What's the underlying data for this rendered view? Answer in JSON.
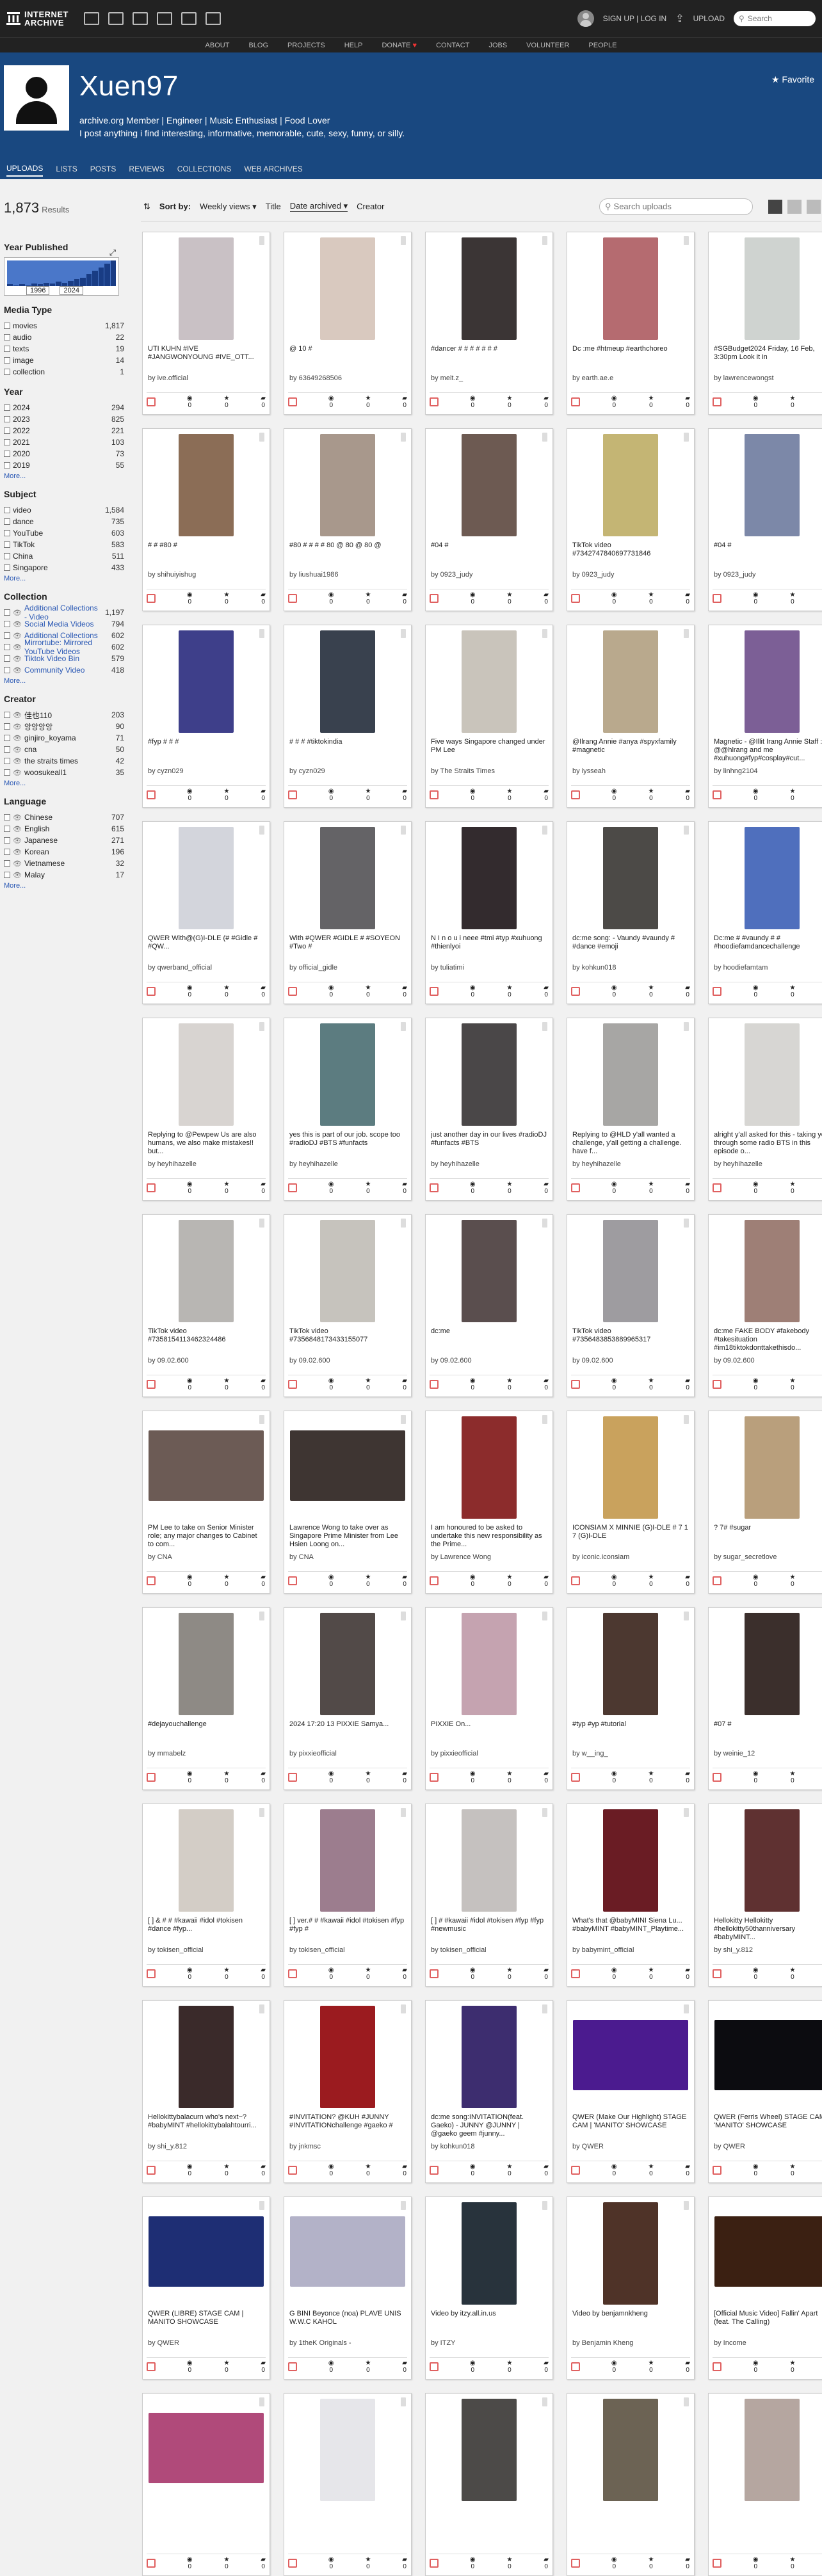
{
  "header": {
    "logo_line1": "INTERNET",
    "logo_line2": "ARCHIVE",
    "signup": "SIGN UP | LOG IN",
    "upload": "UPLOAD",
    "search_placeholder": "Search"
  },
  "subnav": [
    "ABOUT",
    "BLOG",
    "PROJECTS",
    "HELP",
    "DONATE",
    "CONTACT",
    "JOBS",
    "VOLUNTEER",
    "PEOPLE"
  ],
  "profile": {
    "name": "Xuen97",
    "bio1": "archive.org Member | Engineer | Music Enthusiast | Food Lover",
    "bio2": "I post anything i find interesting, informative, memorable, cute, sexy, funny, or silly.",
    "favorite": "Favorite",
    "tabs": [
      "UPLOADS",
      "LISTS",
      "POSTS",
      "REVIEWS",
      "COLLECTIONS",
      "WEB ARCHIVES"
    ]
  },
  "sidebar": {
    "results": "1,873",
    "results_label": "Results",
    "year_published": "Year Published",
    "year_from": "1996",
    "year_to": "2024",
    "year_histogram": [
      2,
      1,
      2,
      1,
      3,
      2,
      4,
      3,
      5,
      4,
      6,
      8,
      10,
      14,
      18,
      22,
      26,
      30
    ],
    "media_type": {
      "title": "Media Type",
      "items": [
        {
          "label": "movies",
          "count": "1,817"
        },
        {
          "label": "audio",
          "count": "22"
        },
        {
          "label": "texts",
          "count": "19"
        },
        {
          "label": "image",
          "count": "14"
        },
        {
          "label": "collection",
          "count": "1"
        }
      ]
    },
    "year": {
      "title": "Year",
      "items": [
        {
          "label": "2024",
          "count": "294"
        },
        {
          "label": "2023",
          "count": "825"
        },
        {
          "label": "2022",
          "count": "221"
        },
        {
          "label": "2021",
          "count": "103"
        },
        {
          "label": "2020",
          "count": "73"
        },
        {
          "label": "2019",
          "count": "55"
        }
      ],
      "more": "More..."
    },
    "subject": {
      "title": "Subject",
      "items": [
        {
          "label": "video",
          "count": "1,584"
        },
        {
          "label": "dance",
          "count": "735"
        },
        {
          "label": "YouTube",
          "count": "603"
        },
        {
          "label": "TikTok",
          "count": "583"
        },
        {
          "label": "China",
          "count": "511"
        },
        {
          "label": "Singapore",
          "count": "433"
        }
      ],
      "more": "More..."
    },
    "collection": {
      "title": "Collection",
      "items": [
        {
          "label": "Additional Collections - Video",
          "count": "1,197"
        },
        {
          "label": "Social Media Videos",
          "count": "794"
        },
        {
          "label": "Additional Collections",
          "count": "602"
        },
        {
          "label": "Mirrortube: Mirrored YouTube Videos",
          "count": "602"
        },
        {
          "label": "Tiktok Video Bin",
          "count": "579"
        },
        {
          "label": "Community Video",
          "count": "418"
        }
      ],
      "more": "More..."
    },
    "creator": {
      "title": "Creator",
      "items": [
        {
          "label": "佳也110",
          "count": "203"
        },
        {
          "label": "앙앙앙앙",
          "count": "90"
        },
        {
          "label": "ginjiro_koyama",
          "count": "71"
        },
        {
          "label": "cna",
          "count": "50"
        },
        {
          "label": "the straits times",
          "count": "42"
        },
        {
          "label": "woosukeall1",
          "count": "35"
        }
      ],
      "more": "More..."
    },
    "language": {
      "title": "Language",
      "items": [
        {
          "label": "Chinese",
          "count": "707"
        },
        {
          "label": "English",
          "count": "615"
        },
        {
          "label": "Japanese",
          "count": "271"
        },
        {
          "label": "Korean",
          "count": "196"
        },
        {
          "label": "Vietnamese",
          "count": "32"
        },
        {
          "label": "Malay",
          "count": "17"
        }
      ],
      "more": "More..."
    }
  },
  "toolbar": {
    "sort_by": "Sort by:",
    "weekly": "Weekly views",
    "title": "Title",
    "date_archived": "Date archived",
    "creator": "Creator",
    "search_placeholder": "Search uploads"
  },
  "tiles": [
    {
      "title": "UTI KUHN #IVE #JANGWONYOUNG #IVE_OTT...",
      "by": "by ive.official",
      "color": "#c9c1c5"
    },
    {
      "title": "@ 10 #",
      "by": "by 63649268506",
      "color": "#d9c9bf"
    },
    {
      "title": "#dancer # # # # # # #",
      "by": "by meit.z_",
      "color": "#3b3535"
    },
    {
      "title": "Dc :me #htmeup #earthchoreo",
      "by": "by earth.ae.e",
      "color": "#b56b70"
    },
    {
      "title": "#SGBudget2024 Friday, 16 Feb, 3:30pm Look it in",
      "by": "by lawrencewongst",
      "color": "#cfd3d0"
    },
    {
      "title": "# # #80 #",
      "by": "by shihuiyishug",
      "color": "#8b6d56"
    },
    {
      "title": "#80 # # # # 80 @ 80 @ 80 @",
      "by": "by liushuai1986",
      "color": "#a8988c"
    },
    {
      "title": "#04 #",
      "by": "by 0923_judy",
      "color": "#6d5a52"
    },
    {
      "title": "TikTok video #7342747840697731846",
      "by": "by 0923_judy",
      "color": "#c4b574"
    },
    {
      "title": "#04 #",
      "by": "by 0923_judy",
      "color": "#7c88a8"
    },
    {
      "title": "#fyp # # #",
      "by": "by cyzn029",
      "color": "#3e3f8a"
    },
    {
      "title": "# # # #tiktokindia",
      "by": "by cyzn029",
      "color": "#39414e"
    },
    {
      "title": "Five ways Singapore changed under PM Lee",
      "by": "by The Straits Times",
      "color": "#c9c4bb"
    },
    {
      "title": "@Ilrang Annie #anya #spyxfamily #magnetic",
      "by": "by iysseah",
      "color": "#b9a98d"
    },
    {
      "title": "Magnetic - @Illit Irang Annie Staff : @@hlrang and me #xuhuong#fyp#cosplay#cut...",
      "by": "by linhng2104",
      "color": "#7c5f96"
    },
    {
      "title": "QWER With@(G)I-DLE (# #Gidle # #QW...",
      "by": "by qwerband_official",
      "color": "#d3d5dc"
    },
    {
      "title": "With #QWER #GIDLE # #SOYEON #Two #",
      "by": "by official_gidle",
      "color": "#646366"
    },
    {
      "title": "N I n o u i neee #tmi #typ #xuhuong #thienlyoi",
      "by": "by tuliatimi",
      "color": "#332b2e"
    },
    {
      "title": "dc:me song: - Vaundy #vaundy # #dance #emoji",
      "by": "by kohkun018",
      "color": "#4c4a47"
    },
    {
      "title": "Dc:me # #vaundy # # #hoodiefamdancechallenge",
      "by": "by hoodiefamtam",
      "color": "#4f6fbd"
    },
    {
      "title": "Replying to @Pewpew Us are also humans, we also make mistakes!! but...",
      "by": "by heyhihazelle",
      "color": "#d8d4d1"
    },
    {
      "title": "yes this is part of our job. scope too #radioDJ #BTS #funfacts",
      "by": "by heyhihazelle",
      "color": "#5c7c80"
    },
    {
      "title": "just another day in our lives #radioDJ #funfacts #BTS",
      "by": "by heyhihazelle",
      "color": "#4a4748"
    },
    {
      "title": "Replying to @HLD y'all wanted a challenge, y'all getting a challenge. have f...",
      "by": "by heyhihazelle",
      "color": "#a7a6a4"
    },
    {
      "title": "alright y'all asked for this - taking you through some radio BTS in this episode o...",
      "by": "by heyhihazelle",
      "color": "#d7d6d3"
    },
    {
      "title": "TikTok video #7358154113462324486",
      "by": "by 09.02.600",
      "color": "#b8b6b3"
    },
    {
      "title": "TikTok video #7356848173433155077",
      "by": "by 09.02.600",
      "color": "#c6c3bd"
    },
    {
      "title": "dc:me",
      "by": "by 09.02.600",
      "color": "#5a4e4e"
    },
    {
      "title": "TikTok video #7356483853889965317",
      "by": "by 09.02.600",
      "color": "#9e9ca0"
    },
    {
      "title": "dc:me FAKE BODY #fakebody #takesituation #im18tiktokdonttakethisdo...",
      "by": "by 09.02.600",
      "color": "#9e7f76"
    },
    {
      "title": "PM Lee to take on Senior Minister role; any major changes to Cabinet to com...",
      "by": "by CNA",
      "color": "#6c5b55",
      "wide": true
    },
    {
      "title": "Lawrence Wong to take over as Singapore Prime Minister from Lee Hsien Loong on...",
      "by": "by CNA",
      "color": "#3e3532",
      "wide": true
    },
    {
      "title": "I am honoured to be asked to undertake this new responsibility as the Prime...",
      "by": "by Lawrence Wong",
      "color": "#8c2c2c"
    },
    {
      "title": "ICONSIAM X MINNIE (G)I-DLE # 7 1 7 (G)I-DLE",
      "by": "by iconic.iconsiam",
      "color": "#c9a25d"
    },
    {
      "title": "? 7# #sugar",
      "by": "by sugar_secretlove",
      "color": "#b99f7c"
    },
    {
      "title": "#dejayouchallenge",
      "by": "by mmabelz",
      "color": "#8e8a85"
    },
    {
      "title": "2024 17:20 13 PIXXIE Samya...",
      "by": "by pixxieofficial",
      "color": "#524a48"
    },
    {
      "title": "PIXXIE On...",
      "by": "by pixxieofficial",
      "color": "#c5a3b0"
    },
    {
      "title": "#typ #yp #tutorial",
      "by": "by w__ing_",
      "color": "#4c3830"
    },
    {
      "title": "#07 #",
      "by": "by weinie_12",
      "color": "#3b2f2c"
    },
    {
      "title": "[ ] & # # #kawaii #idol #tokisen #dance #fyp...",
      "by": "by tokisen_official",
      "color": "#d3cdc6"
    },
    {
      "title": "[ ] ver.# # #kawaii #idol #tokisen #fyp #fyp #",
      "by": "by tokisen_official",
      "color": "#9c7d8e"
    },
    {
      "title": "[ ] # #kawaii #idol #tokisen #fyp #fyp #newmusic",
      "by": "by tokisen_official",
      "color": "#c5c1bf"
    },
    {
      "title": "What's that @babyMINI Siena Lu... #babyMINT #babyMINT_Playtime...",
      "by": "by babymint_official",
      "color": "#6a1c24"
    },
    {
      "title": "Hellokitty Hellokitty #hellokitty50thanniversary #babyMINT...",
      "by": "by shi_y.812",
      "color": "#5f3131"
    },
    {
      "title": "Hellokittybalacurn who's next~? #babyMINT #hellokittybalahtourri...",
      "by": "by shi_y.812",
      "color": "#3a2a2a"
    },
    {
      "title": "#INVITATION? @KUH #JUNNY #INVITATIONchallenge #gaeko #",
      "by": "by jnkmsc",
      "color": "#9b1b1f"
    },
    {
      "title": "dc:me song:INVITATION(feat. Gaeko) - JUNNY @JUNNY | @gaeko geem #junny...",
      "by": "by kohkun018",
      "color": "#3d2d6f"
    },
    {
      "title": "QWER (Make Our Highlight) STAGE CAM | 'MANITO' SHOWCASE",
      "by": "by QWER",
      "color": "#4b1b8f",
      "wide": true
    },
    {
      "title": "QWER (Ferris Wheel) STAGE CAM | 'MANITO' SHOWCASE",
      "by": "by QWER",
      "color": "#0c0c10",
      "wide": true
    },
    {
      "title": "QWER (LIBRE) STAGE CAM | MANITO SHOWCASE",
      "by": "by QWER",
      "color": "#1e2e74",
      "wide": true
    },
    {
      "title": "G BINI Beyonce (noa) PLAVE UNIS W.W.C KAHOL",
      "by": "by 1theK Originals -",
      "color": "#b3b2c8",
      "wide": true
    },
    {
      "title": "Video by itzy.all.in.us",
      "by": "by ITZY",
      "color": "#28333c"
    },
    {
      "title": "Video by benjamnkheng",
      "by": "by Benjamin Kheng",
      "color": "#4f3328"
    },
    {
      "title": "[Official Music Video] Fallin' Apart (feat. The Calling)",
      "by": "by Income",
      "color": "#3b2012",
      "wide": true
    },
    {
      "title": "",
      "by": "",
      "color": "#b04a7a",
      "wide": true
    },
    {
      "title": "",
      "by": "",
      "color": "#e6e6ea"
    },
    {
      "title": "",
      "by": "",
      "color": "#4c4a48"
    },
    {
      "title": "",
      "by": "",
      "color": "#6c6354"
    },
    {
      "title": "",
      "by": "",
      "color": "#b5a6a0"
    }
  ],
  "stats_counts": [
    "0",
    "0",
    "0"
  ]
}
